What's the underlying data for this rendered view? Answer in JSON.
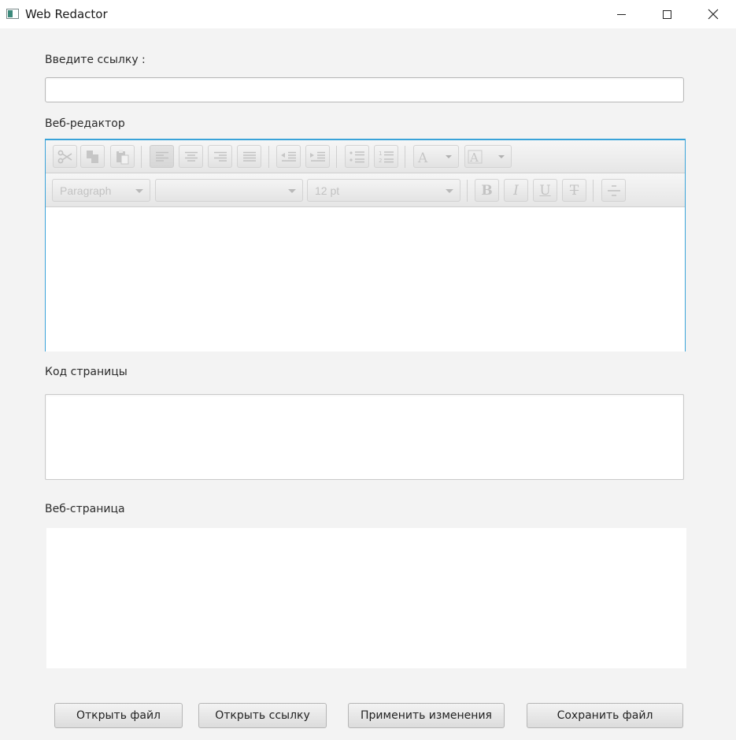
{
  "window": {
    "title": "Web Redactor"
  },
  "url_section": {
    "label": "Введите ссылку :",
    "value": ""
  },
  "editor": {
    "label": "Веб-редактор",
    "paragraph_format": "Paragraph",
    "font_family": "",
    "font_size": "12 pt",
    "toolbar_row1": [
      "cut-icon",
      "copy-icon",
      "paste-icon",
      "align-left-icon",
      "align-center-icon",
      "align-right-icon",
      "align-justify-icon",
      "outdent-icon",
      "indent-icon",
      "bullet-list-icon",
      "numbered-list-icon",
      "text-color-icon",
      "background-color-icon"
    ],
    "toolbar_row2": [
      "bold-icon",
      "italic-icon",
      "underline-icon",
      "strikethrough-icon",
      "horizontal-rule-icon"
    ],
    "format_glyphs": {
      "bold": "B",
      "italic": "I",
      "underline": "U",
      "strike": "T"
    },
    "color_glyph": "A",
    "content": ""
  },
  "code_section": {
    "label": "Код страницы",
    "value": ""
  },
  "webpage_section": {
    "label": "Веб-страница"
  },
  "buttons": {
    "open_file": "Открыть файл",
    "open_link": "Открыть ссылку",
    "apply_changes": "Применить изменения",
    "save_file": "Сохранить файл"
  }
}
